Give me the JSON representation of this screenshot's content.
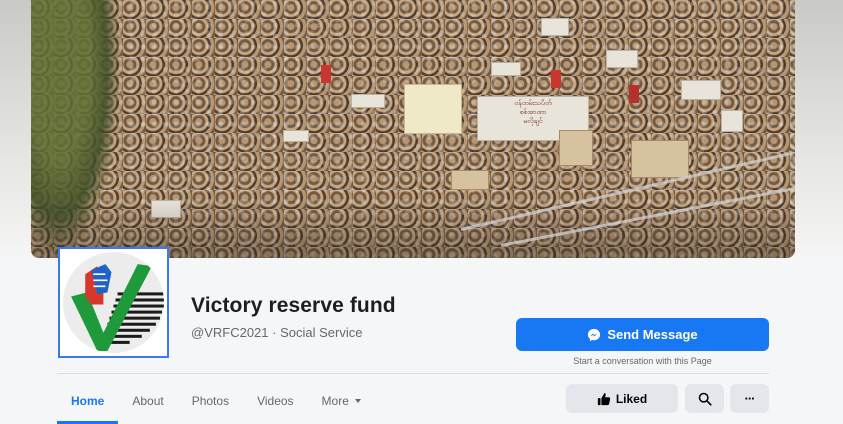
{
  "cover": {
    "signs": [
      "ဝန်ထမ်းသပိတ်",
      "စစ်အာဏာ",
      "မလိုချင်"
    ]
  },
  "page": {
    "name": "Victory reserve fund",
    "handle": "@VRFC2021",
    "separator": " · ",
    "category": "Social Service"
  },
  "actions": {
    "send_message_label": "Send Message",
    "send_message_hint": "Start a conversation with this Page",
    "liked_label": "Liked",
    "more_glyph": "···"
  },
  "tabs": [
    {
      "label": "Home",
      "active": true
    },
    {
      "label": "About",
      "active": false
    },
    {
      "label": "Photos",
      "active": false
    },
    {
      "label": "Videos",
      "active": false
    },
    {
      "label": "More",
      "active": false
    }
  ],
  "colors": {
    "accent": "#1877f2",
    "avatar_frame": "#3b79f0",
    "button_gray": "#e4e6eb",
    "logo_green": "#1e9a3a",
    "logo_red": "#d8382c",
    "logo_blue": "#1f62c8"
  },
  "icons": {
    "messenger": "messenger-icon",
    "like": "thumbs-up-icon",
    "search": "search-icon",
    "more": "ellipsis-icon",
    "dropdown": "caret-down-icon"
  }
}
